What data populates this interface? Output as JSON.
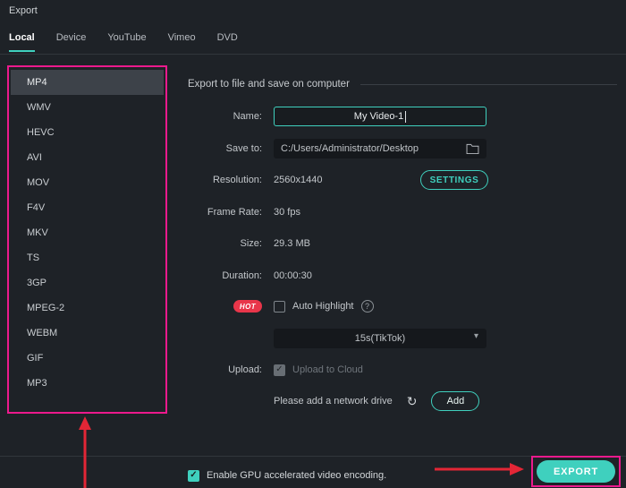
{
  "window": {
    "title": "Export"
  },
  "tabs": [
    {
      "label": "Local",
      "active": true
    },
    {
      "label": "Device",
      "active": false
    },
    {
      "label": "YouTube",
      "active": false
    },
    {
      "label": "Vimeo",
      "active": false
    },
    {
      "label": "DVD",
      "active": false
    }
  ],
  "sidebar": {
    "formats": [
      "MP4",
      "WMV",
      "HEVC",
      "AVI",
      "MOV",
      "F4V",
      "MKV",
      "TS",
      "3GP",
      "MPEG-2",
      "WEBM",
      "GIF",
      "MP3"
    ],
    "selected": "MP4"
  },
  "main": {
    "section_title": "Export to file and save on computer",
    "name": {
      "label": "Name:",
      "value": "My Video-1"
    },
    "save_to": {
      "label": "Save to:",
      "value": "C:/Users/Administrator/Desktop"
    },
    "resolution": {
      "label": "Resolution:",
      "value": "2560x1440",
      "settings_button": "SETTINGS"
    },
    "frame_rate": {
      "label": "Frame Rate:",
      "value": "30 fps"
    },
    "size": {
      "label": "Size:",
      "value": "29.3 MB"
    },
    "duration": {
      "label": "Duration:",
      "value": "00:00:30"
    },
    "auto_highlight": {
      "hot_badge": "HOT",
      "label": "Auto Highlight",
      "checked": false,
      "help_icon": "?"
    },
    "preset": {
      "value": "15s(TikTok)",
      "chevron": "▾"
    },
    "upload": {
      "label": "Upload:",
      "cloud_label": "Upload to Cloud",
      "checked": true,
      "check_glyph": "✓"
    },
    "network": {
      "text": "Please add a network drive",
      "refresh_icon": "↻",
      "add_button": "Add"
    }
  },
  "footer": {
    "gpu_label": "Enable GPU accelerated video encoding.",
    "gpu_checked": true,
    "check_glyph": "✓",
    "export_button": "EXPORT"
  },
  "colors": {
    "accent_teal": "#3fd0be",
    "annotation_pink": "#ec1a8d",
    "arrow_red": "#e32636",
    "hot_red": "#e8364a",
    "selected_row": "#3d4249",
    "background": "#1e2227"
  }
}
